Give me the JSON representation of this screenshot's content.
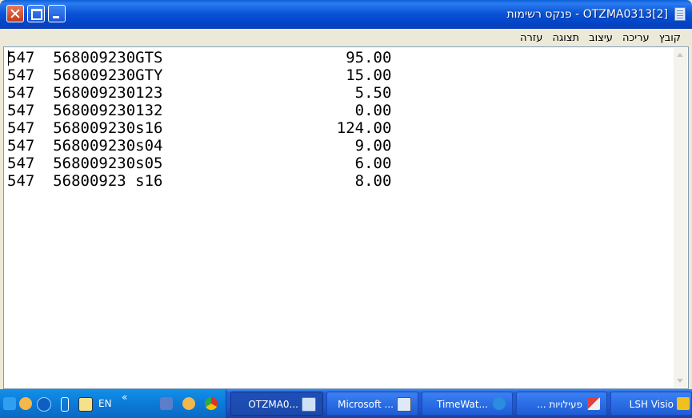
{
  "window": {
    "title": "[2‎]OTZMA0313 - פנקס רשימות"
  },
  "menu": [
    "קובץ",
    "עריכה",
    "עיצוב",
    "תצוגה",
    "עזרה"
  ],
  "lines": [
    "547  568009230GTS                    95.00",
    "547  568009230GTY                    15.00",
    "547  568009230123                     5.50",
    "547  568009230132                     0.00",
    "547  568009230s16                   124.00",
    "547  568009230s04                     9.00",
    "547  568009230s05                     6.00",
    "547  56800923 s16                     8.00"
  ],
  "taskbar": {
    "lang": "EN",
    "chevron": "«",
    "tasks": [
      {
        "label": "LSH Visio",
        "icon": "visio-icon",
        "color": "#f0c020"
      },
      {
        "label": "פעילויות ...",
        "icon": "paint-icon",
        "color": "#e04040"
      },
      {
        "label": "TimeWat...",
        "icon": "ie-icon",
        "color": "#2c8ce0"
      },
      {
        "label": "Microsoft ...",
        "icon": "word-icon",
        "color": "#dfe8f5"
      },
      {
        "label": "OTZMA0...",
        "icon": "notepad-icon",
        "color": "#cfe0f7",
        "active": true
      }
    ]
  }
}
